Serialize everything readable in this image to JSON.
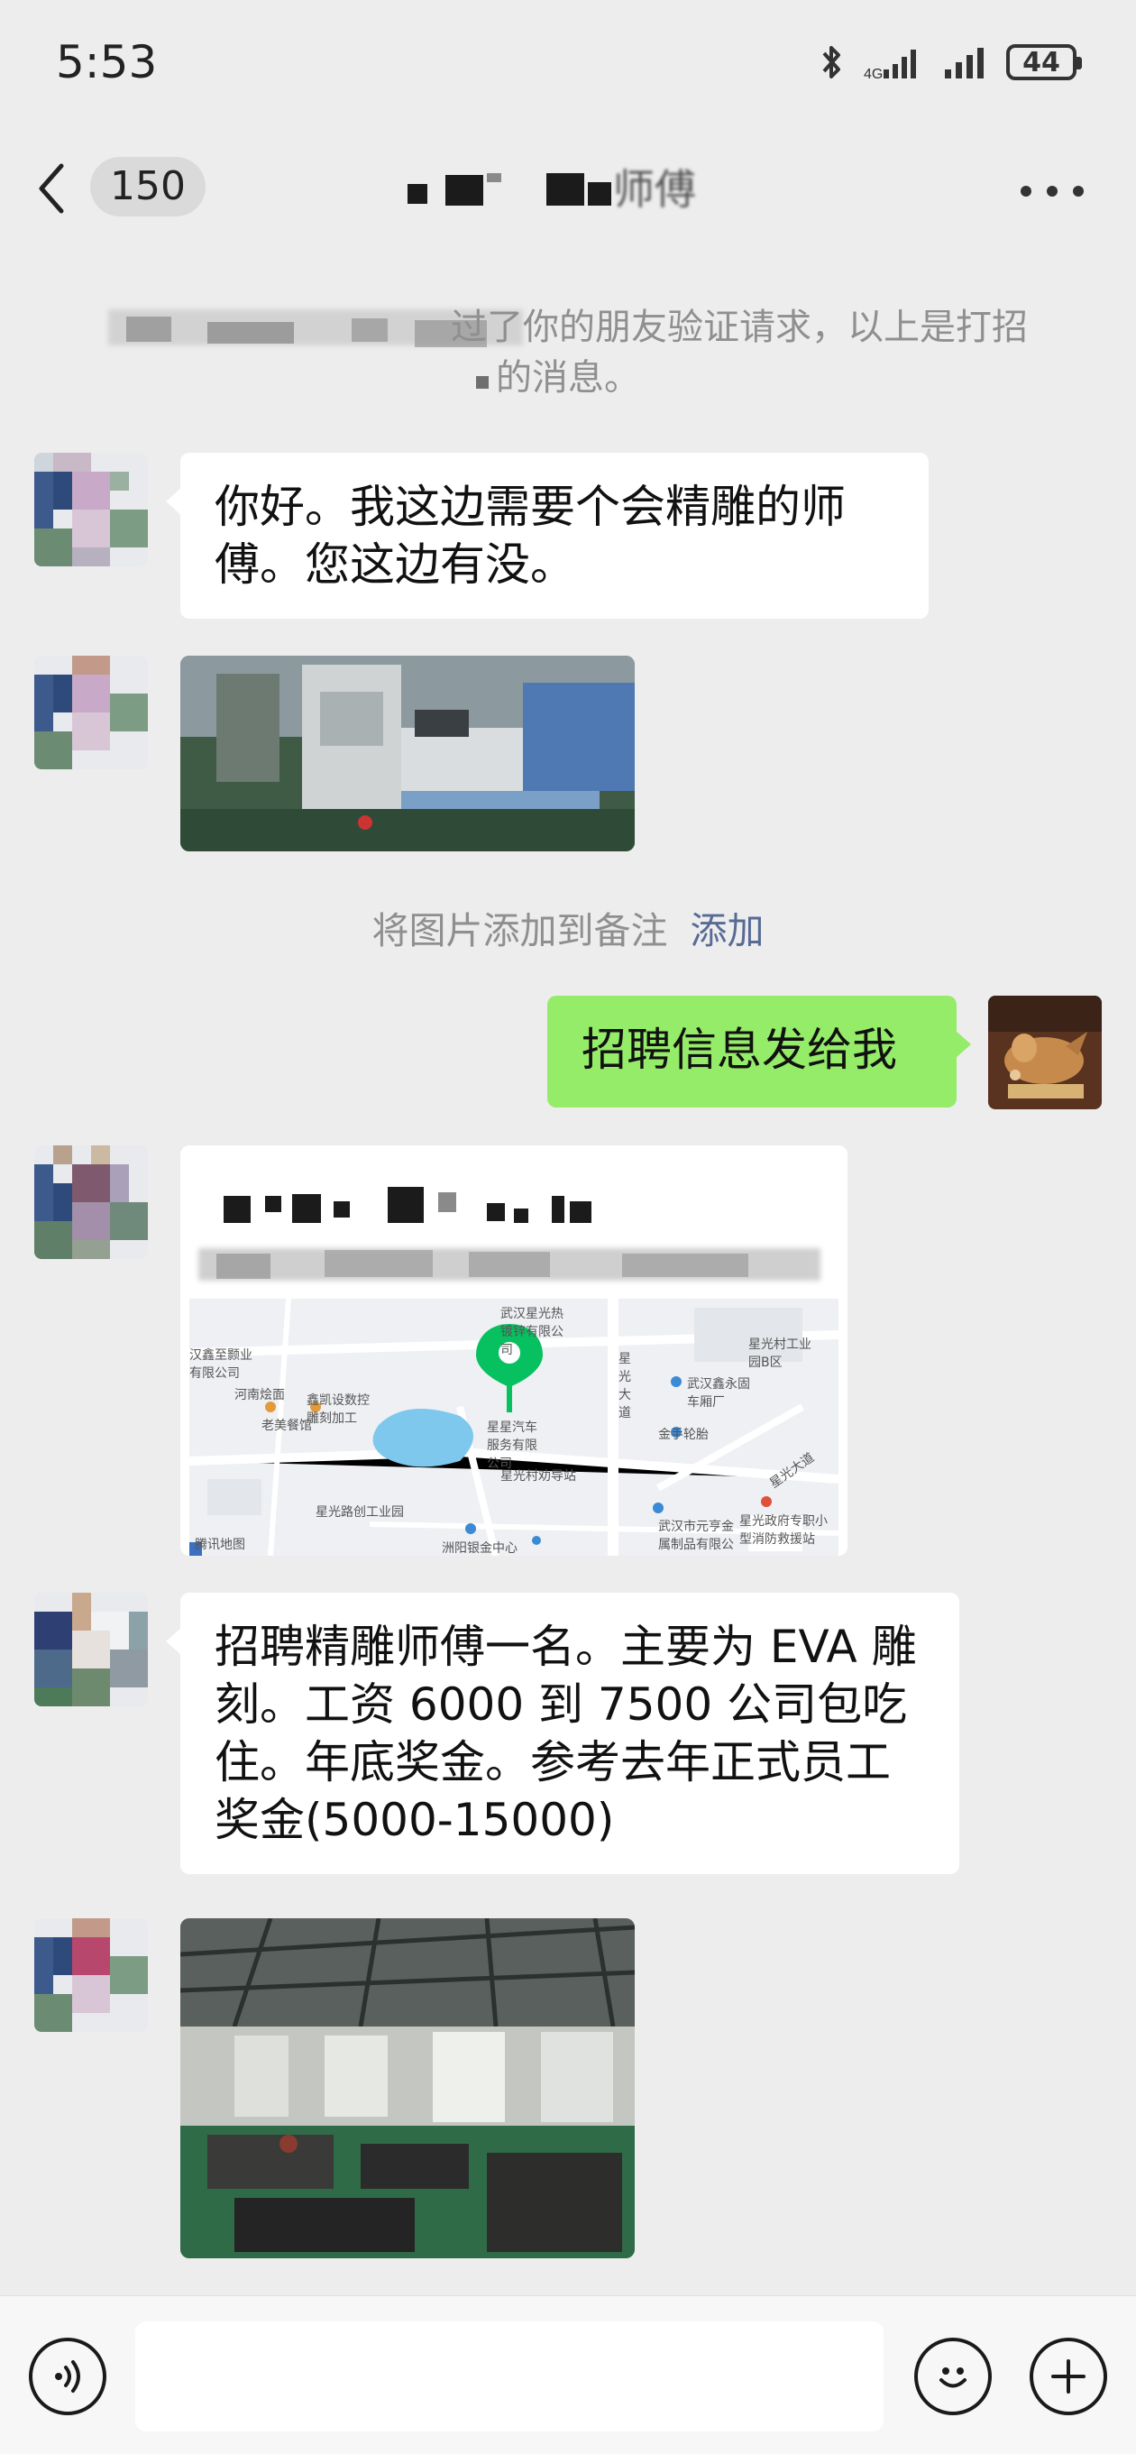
{
  "status_bar": {
    "time": "5:53",
    "battery": "44",
    "icons": [
      "bluetooth-icon",
      "signal-icon",
      "signal-icon",
      "battery-icon"
    ]
  },
  "header": {
    "back_icon": "chevron-left-icon",
    "unread_count": "150",
    "title_visible_fragment": "师傅",
    "more_icon": "more-icon"
  },
  "system_notices": {
    "friend_request_line1": "过了你的朋友验证请求，以上是打招",
    "friend_request_line2": "的消息。",
    "add_image_note": "将图片添加到备注",
    "add_link": "添加"
  },
  "messages": [
    {
      "from": "contact",
      "type": "text",
      "text": "你好。我这边需要个会精雕的师傅。您这边有没。"
    },
    {
      "from": "contact",
      "type": "image",
      "subject": "cnc-machine-photo"
    },
    {
      "from": "me",
      "type": "text",
      "text": "招聘信息发给我"
    },
    {
      "from": "contact",
      "type": "location"
    },
    {
      "from": "contact",
      "type": "text",
      "text": "招聘精雕师傅一名。主要为 EVA 雕刻。工资 6000 到 7500  公司包吃住。年底奖金。参考去年正式员工奖金(5000-15000)"
    },
    {
      "from": "contact",
      "type": "image",
      "subject": "factory-floor-photo"
    }
  ],
  "location_card": {
    "map_labels": {
      "top_company": "武汉星光热镀锌有限公司",
      "left_company": "汉鑫至颢业有限公司",
      "henan": "河南烩面",
      "xinkai": "鑫凯设数控雕刻加工",
      "laomei": "老美餐馆",
      "center_company": "星星汽车服务有限公司",
      "xingguang_village": "星光村工业园B区",
      "xinyong": "武汉鑫永固车厢厂",
      "jinshou": "金手轮胎",
      "road": "星光大道",
      "xingguang_road": "星光村劝导站",
      "xingguang_industrial": "星光路创工业园",
      "yuanheng": "武汉市元亨金属制品有限公司",
      "fire": "星光政府专职小型消防救援站",
      "bank": "洲阳银金中心",
      "map_brand": "腾讯地图",
      "road2": "星光大道"
    }
  },
  "input_bar": {
    "voice_icon": "voice-icon",
    "emoji_icon": "emoji-icon",
    "plus_icon": "plus-icon",
    "placeholder": ""
  },
  "colors": {
    "background": "#EDEDED",
    "my_bubble": "#95EC69",
    "contact_bubble": "#FFFFFF",
    "link": "#576B95",
    "map_pin": "#07C160"
  }
}
